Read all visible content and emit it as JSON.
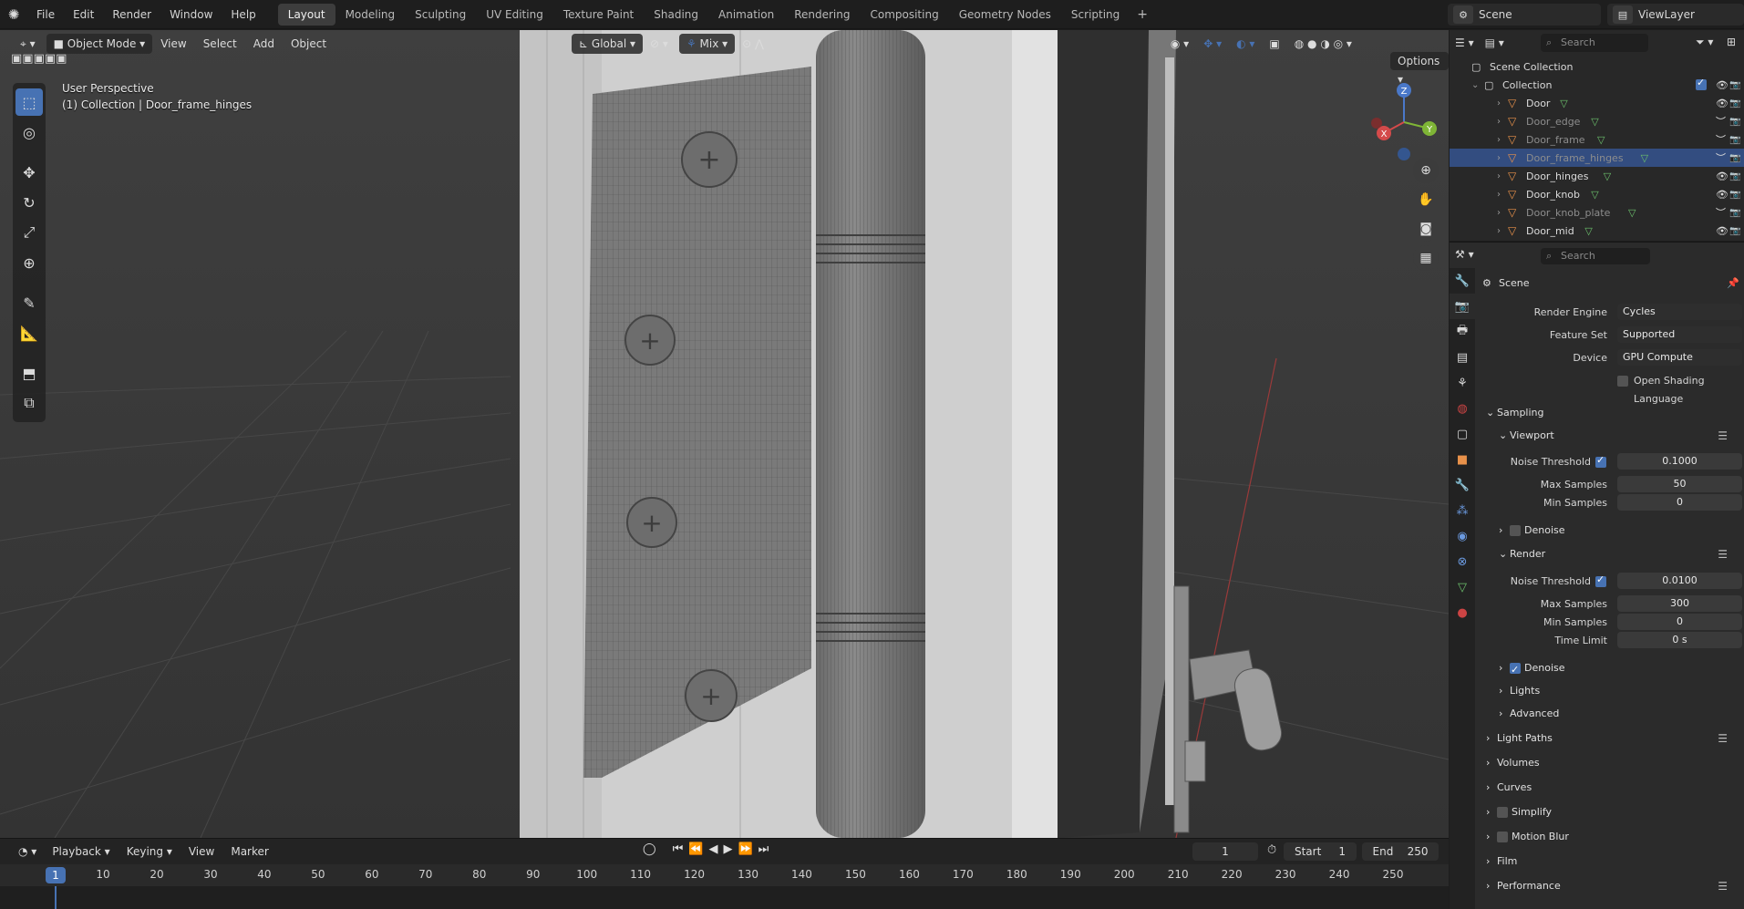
{
  "topbar": {
    "menus": [
      "File",
      "Edit",
      "Render",
      "Window",
      "Help"
    ],
    "workspaces": [
      "Layout",
      "Modeling",
      "Sculpting",
      "UV Editing",
      "Texture Paint",
      "Shading",
      "Animation",
      "Rendering",
      "Compositing",
      "Geometry Nodes",
      "Scripting"
    ],
    "active_workspace": "Layout",
    "add_tab": "+",
    "scene": "Scene",
    "view_layer": "ViewLayer"
  },
  "viewport": {
    "mode": "Object Mode",
    "menus": [
      "View",
      "Select",
      "Add",
      "Object"
    ],
    "orientation": "Global",
    "snap_mode": "Mix",
    "info_line1": "User Perspective",
    "info_line2": "(1) Collection | Door_frame_hinges",
    "options": "Options",
    "gizmo": {
      "x": "X",
      "y": "Y",
      "z": "Z"
    }
  },
  "timeline": {
    "menus": [
      "Playback",
      "Keying",
      "View",
      "Marker"
    ],
    "current_frame": "1",
    "start_label": "Start",
    "start": "1",
    "end_label": "End",
    "end": "250",
    "ruler": [
      "10",
      "20",
      "30",
      "40",
      "50",
      "60",
      "70",
      "80",
      "90",
      "100",
      "110",
      "120",
      "130",
      "140",
      "150",
      "160",
      "170",
      "180",
      "190",
      "200",
      "210",
      "220",
      "230",
      "240",
      "250"
    ],
    "ruler_current": "1"
  },
  "outliner": {
    "search_placeholder": "Search",
    "scene_collection": "Scene Collection",
    "collection": "Collection",
    "objects": [
      {
        "name": "Door",
        "visible": true,
        "selected": false
      },
      {
        "name": "Door_edge",
        "visible": false,
        "selected": false
      },
      {
        "name": "Door_frame",
        "visible": false,
        "selected": false
      },
      {
        "name": "Door_frame_hinges",
        "visible": false,
        "selected": true
      },
      {
        "name": "Door_hinges",
        "visible": true,
        "selected": false
      },
      {
        "name": "Door_knob",
        "visible": true,
        "selected": false
      },
      {
        "name": "Door_knob_plate",
        "visible": false,
        "selected": false
      },
      {
        "name": "Door_mid",
        "visible": true,
        "selected": false
      }
    ]
  },
  "properties": {
    "search_placeholder": "Search",
    "context": "Scene",
    "render_engine_label": "Render Engine",
    "render_engine": "Cycles",
    "feature_set_label": "Feature Set",
    "feature_set": "Supported",
    "device_label": "Device",
    "device": "GPU Compute",
    "osl_label": "Open Shading Language",
    "sampling": "Sampling",
    "viewport_panel": "Viewport",
    "vp_noise_label": "Noise Threshold",
    "vp_noise": "0.1000",
    "vp_max_label": "Max Samples",
    "vp_max": "50",
    "vp_min_label": "Min Samples",
    "vp_min": "0",
    "vp_denoise": "Denoise",
    "render_panel": "Render",
    "r_noise_label": "Noise Threshold",
    "r_noise": "0.0100",
    "r_max_label": "Max Samples",
    "r_max": "300",
    "r_min_label": "Min Samples",
    "r_min": "0",
    "r_time_label": "Time Limit",
    "r_time": "0 s",
    "r_denoise": "Denoise",
    "lights": "Lights",
    "advanced": "Advanced",
    "light_paths": "Light Paths",
    "volumes": "Volumes",
    "curves": "Curves",
    "simplify": "Simplify",
    "motion_blur": "Motion Blur",
    "film": "Film",
    "performance": "Performance"
  },
  "colors": {
    "accent": "#4772b3",
    "selection": "#334d80",
    "object_icon": "#e8914a",
    "mesh_icon": "#6cc06c"
  }
}
